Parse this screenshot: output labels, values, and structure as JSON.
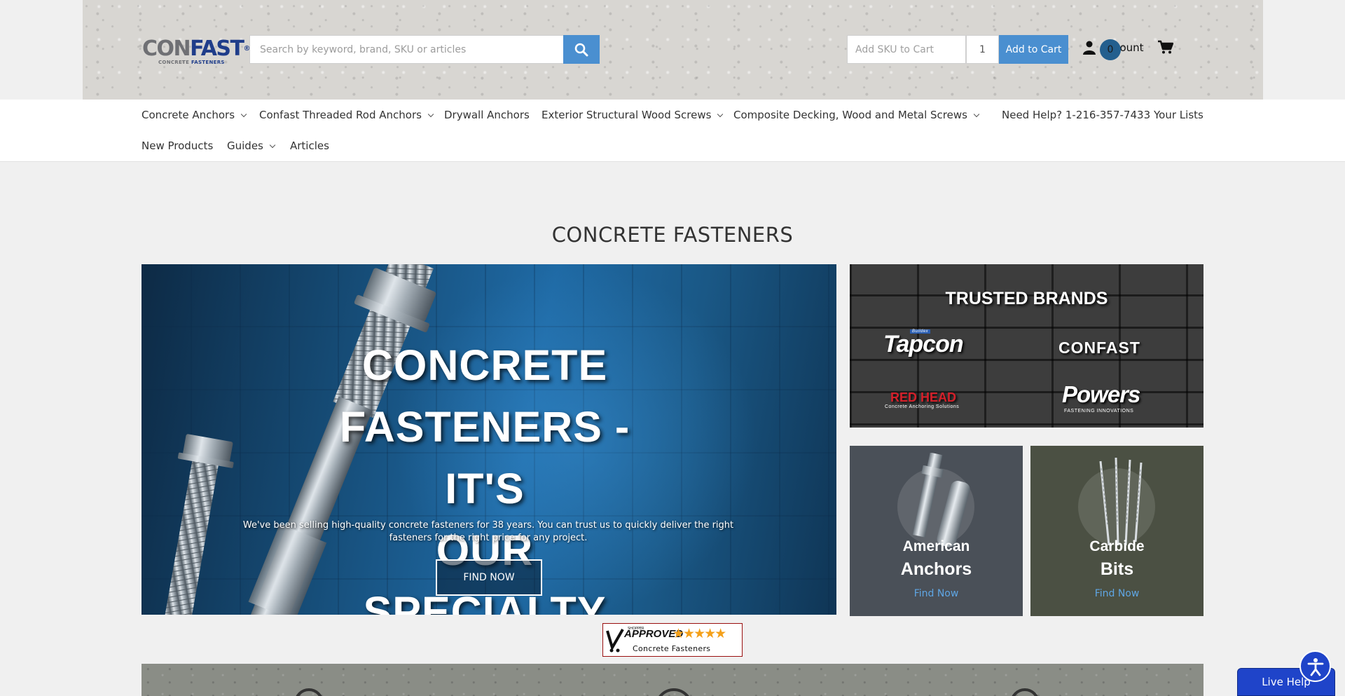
{
  "header": {
    "logo": {
      "text_left": "CON",
      "text_right": "FAST",
      "reg": "®",
      "sub_left": "CONCRETE",
      "sub_right": "FASTENERS"
    },
    "search": {
      "placeholder": "Search by keyword, brand, SKU or articles",
      "value": ""
    },
    "quick_add": {
      "sku_placeholder": "Add SKU to Cart",
      "qty_value": "1",
      "button_label": "Add to Cart"
    },
    "account_label": "Account",
    "cart_count": "0",
    "colors": {
      "brand_blue": "#1f3d8a",
      "button_blue": "#4a8fd0",
      "cart_badge": "#235f8e"
    }
  },
  "nav": {
    "row1": [
      {
        "label": "Concrete Anchors",
        "has_dropdown": true
      },
      {
        "label": "Confast Threaded Rod Anchors",
        "has_dropdown": true
      },
      {
        "label": "Drywall Anchors",
        "has_dropdown": false
      },
      {
        "label": "Exterior Structural Wood Screws",
        "has_dropdown": true
      },
      {
        "label": "Composite Decking, Wood and Metal Screws",
        "has_dropdown": true
      }
    ],
    "help": "Need Help? 1-216-357-7433",
    "lists": "Your Lists",
    "row2": [
      {
        "label": "New Products",
        "has_dropdown": false
      },
      {
        "label": "Guides",
        "has_dropdown": true
      },
      {
        "label": "Articles",
        "has_dropdown": false
      }
    ]
  },
  "main": {
    "page_title": "CONCRETE FASTENERS",
    "hero": {
      "heading_line1": "CONCRETE",
      "heading_line2": "FASTENERS - IT'S",
      "heading_line3": "OUR SPECIALTY",
      "text": "We've been selling high-quality concrete fasteners for 38 years. You can trust us to quickly deliver the right fasteners for the right price for any project.",
      "button_label": "FIND NOW"
    },
    "brands": {
      "title": "TRUSTED BRANDS",
      "tapcon": "Tapcon",
      "tapcon_tag": "Buildex",
      "confast": "CONFAST",
      "redhead": "RED HEAD",
      "redhead_sub": "Concrete Anchoring Solutions",
      "powers": "Powers",
      "powers_sub": "FASTENING INNOVATIONS"
    },
    "categories": [
      {
        "name_line1": "American",
        "name_line2": "Anchors",
        "link": "Find Now",
        "bg": "#4a5058"
      },
      {
        "name_line1": "Carbide",
        "name_line2": "Bits",
        "link": "Find Now",
        "bg": "#4b5043"
      }
    ],
    "shopper_badge": {
      "small": "SHOPPER",
      "approved": "APPROVED",
      "stars": "★★★★★",
      "name": "Concrete Fasteners"
    }
  },
  "widgets": {
    "live_help": "Live Help"
  }
}
